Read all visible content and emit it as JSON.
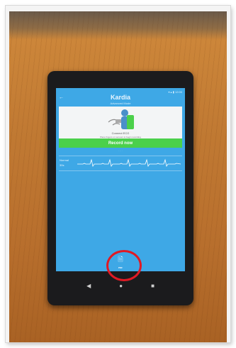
{
  "photo": {
    "description": "Photograph of a tablet on a wooden table showing the Kardia ECG app"
  },
  "app": {
    "title": "Kardia",
    "subtitle": "Advanced Mode",
    "status_bar": "▾ ▴ ▮ 12:00",
    "card_line1": "Connect ECG",
    "card_line2": "Place fingers on sensors to begin recording",
    "record_button": "Record now",
    "small_lines": "· · · ·",
    "ecg_label_top": "Normal",
    "ecg_label_bottom": "30s",
    "doc_caption": "PDF"
  },
  "nav": {
    "back": "◀",
    "home": "●",
    "recents": "■"
  },
  "colors": {
    "screen_blue": "#3ea8e6",
    "record_green": "#4bd04b",
    "highlight_red": "#e01a24"
  }
}
